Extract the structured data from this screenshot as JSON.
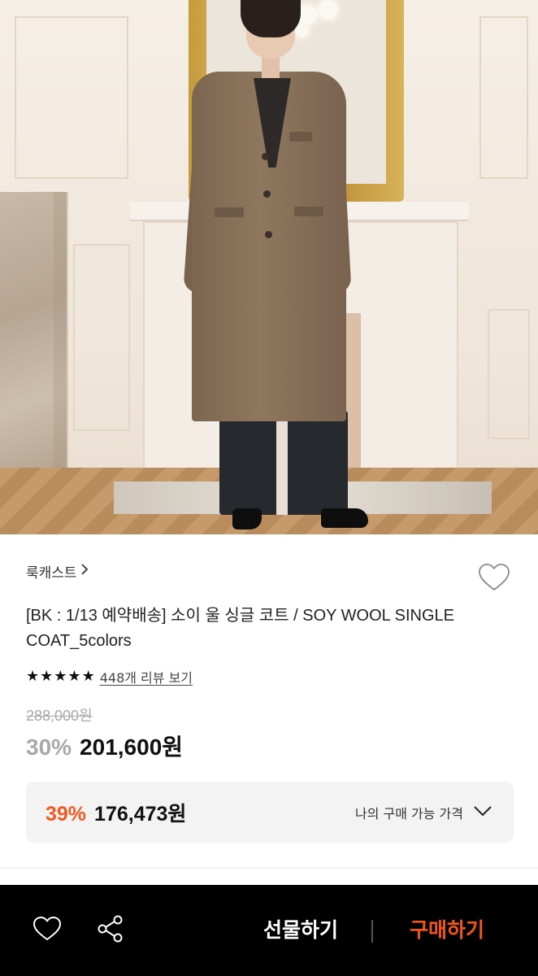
{
  "product": {
    "brand": "룩캐스트",
    "brand_chevron": "›",
    "title": "[BK : 1/13 예약배송] 소이 울 싱글 코트 / SOY WOOL SINGLE COAT_5colors",
    "rating": {
      "stars": 5,
      "star_glyph": "★",
      "review_link": "448개 리뷰 보기"
    },
    "original_price": "288,000원",
    "discount_rate": "30%",
    "sale_price": "201,600원"
  },
  "my_price": {
    "rate": "39%",
    "price": "176,473원",
    "label": "나의 구매 가능 가격"
  },
  "bottom_bar": {
    "gift_label": "선물하기",
    "buy_label": "구매하기"
  },
  "colors": {
    "accent": "#f05a22",
    "buy": "#f3541d",
    "muted": "#a9a9a9"
  },
  "icons": {
    "like": "heart-icon",
    "share": "share-icon",
    "chevron": "chevron-down-icon",
    "brand_arrow": "chevron-right-icon"
  }
}
